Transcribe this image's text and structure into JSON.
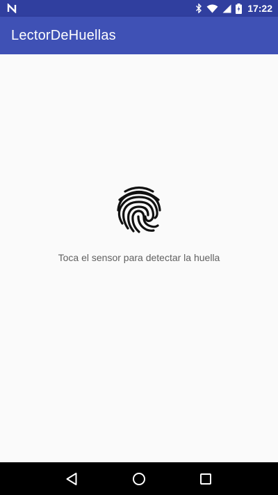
{
  "status_bar": {
    "time": "17:22",
    "icons": [
      "notification-n-icon",
      "bluetooth-icon",
      "wifi-icon",
      "cellular-signal-icon",
      "battery-charging-icon"
    ],
    "background": "#303f9f"
  },
  "app_bar": {
    "title": "LectorDeHuellas",
    "background": "#3f51b5"
  },
  "main": {
    "icon": "fingerprint-icon",
    "instruction": "Toca el sensor para detectar la huella"
  },
  "nav_bar": {
    "buttons": [
      "back-icon",
      "home-icon",
      "recents-icon"
    ]
  }
}
